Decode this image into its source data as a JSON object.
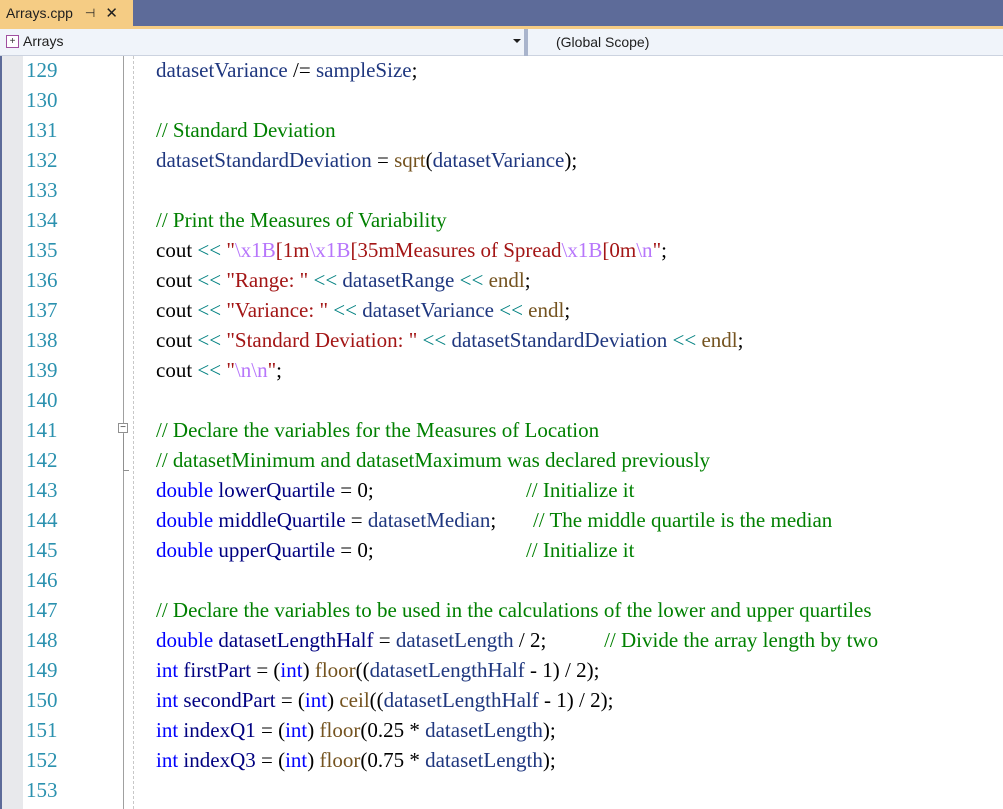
{
  "tab": {
    "title": "Arrays.cpp",
    "pin_icon": "⊣",
    "close_icon": "✕"
  },
  "nav": {
    "project": "Arrays",
    "scope": "(Global Scope)"
  },
  "lines": [
    {
      "n": "129",
      "tokens": [
        [
          "var",
          "datasetVariance"
        ],
        [
          "pl",
          " /= "
        ],
        [
          "var",
          "sampleSize"
        ],
        [
          "pl",
          ";"
        ]
      ]
    },
    {
      "n": "130",
      "tokens": []
    },
    {
      "n": "131",
      "tokens": [
        [
          "cm",
          "// Standard Deviation"
        ]
      ]
    },
    {
      "n": "132",
      "tokens": [
        [
          "var",
          "datasetStandardDeviation"
        ],
        [
          "pl",
          " = "
        ],
        [
          "fn",
          "sqrt"
        ],
        [
          "pl",
          "("
        ],
        [
          "var",
          "datasetVariance"
        ],
        [
          "pl",
          ");"
        ]
      ]
    },
    {
      "n": "133",
      "tokens": []
    },
    {
      "n": "134",
      "tokens": [
        [
          "cm",
          "// Print the Measures of Variability"
        ]
      ]
    },
    {
      "n": "135",
      "tokens": [
        [
          "pl",
          "cout "
        ],
        [
          "op",
          "<<"
        ],
        [
          "str",
          " \""
        ],
        [
          "esc",
          "\\x1B"
        ],
        [
          "str",
          "[1m"
        ],
        [
          "esc",
          "\\x1B"
        ],
        [
          "str",
          "[35mMeasures of Spread"
        ],
        [
          "esc",
          "\\x1B"
        ],
        [
          "str",
          "[0m"
        ],
        [
          "esc",
          "\\n"
        ],
        [
          "str",
          "\""
        ],
        [
          "pl",
          ";"
        ]
      ]
    },
    {
      "n": "136",
      "tokens": [
        [
          "pl",
          "cout "
        ],
        [
          "op",
          "<<"
        ],
        [
          "str",
          " \"Range: \" "
        ],
        [
          "op",
          "<<"
        ],
        [
          "var",
          " datasetRange "
        ],
        [
          "op",
          "<<"
        ],
        [
          "fn",
          " endl"
        ],
        [
          "pl",
          ";"
        ]
      ]
    },
    {
      "n": "137",
      "tokens": [
        [
          "pl",
          "cout "
        ],
        [
          "op",
          "<<"
        ],
        [
          "str",
          " \"Variance: \" "
        ],
        [
          "op",
          "<<"
        ],
        [
          "var",
          " datasetVariance "
        ],
        [
          "op",
          "<<"
        ],
        [
          "fn",
          " endl"
        ],
        [
          "pl",
          ";"
        ]
      ]
    },
    {
      "n": "138",
      "tokens": [
        [
          "pl",
          "cout "
        ],
        [
          "op",
          "<<"
        ],
        [
          "str",
          " \"Standard Deviation: \" "
        ],
        [
          "op",
          "<<"
        ],
        [
          "var",
          " datasetStandardDeviation "
        ],
        [
          "op",
          "<<"
        ],
        [
          "fn",
          " endl"
        ],
        [
          "pl",
          ";"
        ]
      ]
    },
    {
      "n": "139",
      "tokens": [
        [
          "pl",
          "cout "
        ],
        [
          "op",
          "<<"
        ],
        [
          "str",
          " \""
        ],
        [
          "esc",
          "\\n\\n"
        ],
        [
          "str",
          "\""
        ],
        [
          "pl",
          ";"
        ]
      ]
    },
    {
      "n": "140",
      "tokens": []
    },
    {
      "n": "141",
      "tokens": [
        [
          "cm",
          "// Declare the variables for the Measures of Location"
        ]
      ]
    },
    {
      "n": "142",
      "tokens": [
        [
          "cm",
          "// datasetMinimum and datasetMaximum was declared previously"
        ]
      ]
    },
    {
      "n": "143",
      "tokens": [
        [
          "kw",
          "double"
        ],
        [
          "gv",
          " lowerQuartile"
        ],
        [
          "pl",
          " = 0;                             "
        ],
        [
          "cm",
          "// Initialize it"
        ]
      ]
    },
    {
      "n": "144",
      "tokens": [
        [
          "kw",
          "double"
        ],
        [
          "gv",
          " middleQuartile"
        ],
        [
          "pl",
          " = "
        ],
        [
          "var",
          "datasetMedian"
        ],
        [
          "pl",
          ";       "
        ],
        [
          "cm",
          "// The middle quartile is the median"
        ]
      ]
    },
    {
      "n": "145",
      "tokens": [
        [
          "kw",
          "double"
        ],
        [
          "gv",
          " upperQuartile"
        ],
        [
          "pl",
          " = 0;                             "
        ],
        [
          "cm",
          "// Initialize it"
        ]
      ]
    },
    {
      "n": "146",
      "tokens": []
    },
    {
      "n": "147",
      "tokens": [
        [
          "cm",
          "// Declare the variables to be used in the calculations of the lower and upper quartiles"
        ]
      ]
    },
    {
      "n": "148",
      "tokens": [
        [
          "kw",
          "double"
        ],
        [
          "gv",
          " datasetLengthHalf"
        ],
        [
          "pl",
          " = "
        ],
        [
          "var",
          "datasetLength"
        ],
        [
          "pl",
          " / 2;           "
        ],
        [
          "cm",
          "// Divide the array length by two"
        ]
      ]
    },
    {
      "n": "149",
      "tokens": [
        [
          "kw",
          "int"
        ],
        [
          "gv",
          " firstPart"
        ],
        [
          "pl",
          " = ("
        ],
        [
          "kw",
          "int"
        ],
        [
          "pl",
          ") "
        ],
        [
          "fn",
          "floor"
        ],
        [
          "pl",
          "(("
        ],
        [
          "var",
          "datasetLengthHalf"
        ],
        [
          "pl",
          " - 1) / 2);"
        ]
      ]
    },
    {
      "n": "150",
      "tokens": [
        [
          "kw",
          "int"
        ],
        [
          "gv",
          " secondPart"
        ],
        [
          "pl",
          " = ("
        ],
        [
          "kw",
          "int"
        ],
        [
          "pl",
          ") "
        ],
        [
          "fn",
          "ceil"
        ],
        [
          "pl",
          "(("
        ],
        [
          "var",
          "datasetLengthHalf"
        ],
        [
          "pl",
          " - 1) / 2);"
        ]
      ]
    },
    {
      "n": "151",
      "tokens": [
        [
          "kw",
          "int"
        ],
        [
          "gv",
          " indexQ1"
        ],
        [
          "pl",
          " = ("
        ],
        [
          "kw",
          "int"
        ],
        [
          "pl",
          ") "
        ],
        [
          "fn",
          "floor"
        ],
        [
          "pl",
          "(0.25 * "
        ],
        [
          "var",
          "datasetLength"
        ],
        [
          "pl",
          ");"
        ]
      ]
    },
    {
      "n": "152",
      "tokens": [
        [
          "kw",
          "int"
        ],
        [
          "gv",
          " indexQ3"
        ],
        [
          "pl",
          " = ("
        ],
        [
          "kw",
          "int"
        ],
        [
          "pl",
          ") "
        ],
        [
          "fn",
          "floor"
        ],
        [
          "pl",
          "(0.75 * "
        ],
        [
          "var",
          "datasetLength"
        ],
        [
          "pl",
          ");"
        ]
      ]
    },
    {
      "n": "153",
      "tokens": []
    }
  ]
}
